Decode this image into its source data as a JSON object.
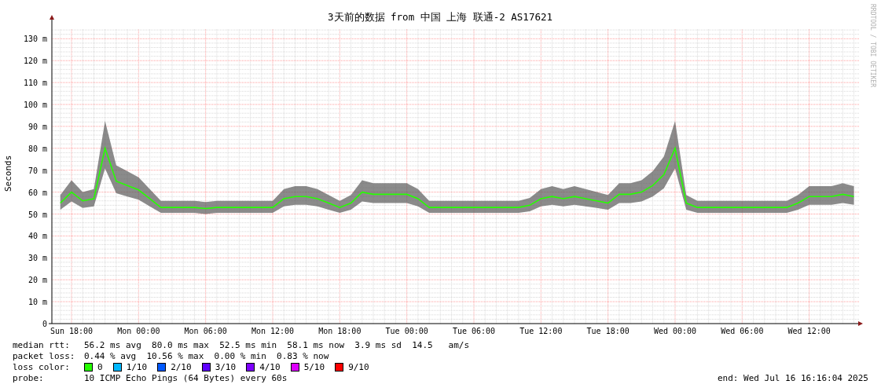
{
  "credit": "RRDTOOL / TOBI OETIKER",
  "chart_data": {
    "type": "line",
    "title": "3天前的数据 from 中国 上海 联通-2 AS17621",
    "ylabel": "Seconds",
    "categories": [
      null,
      "Sun 18:00",
      null,
      null,
      null,
      null,
      null,
      "Mon 00:00",
      null,
      null,
      null,
      null,
      null,
      "Mon 06:00",
      null,
      null,
      null,
      null,
      null,
      "Mon 12:00",
      null,
      null,
      null,
      null,
      null,
      "Mon 18:00",
      null,
      null,
      null,
      null,
      null,
      "Tue 00:00",
      null,
      null,
      null,
      null,
      null,
      "Tue 06:00",
      null,
      null,
      null,
      null,
      null,
      "Tue 12:00",
      null,
      null,
      null,
      null,
      null,
      "Tue 18:00",
      null,
      null,
      null,
      null,
      null,
      "Wed 00:00",
      null,
      null,
      null,
      null,
      null,
      "Wed 06:00",
      null,
      null,
      null,
      null,
      null,
      "Wed 12:00",
      null,
      null,
      null,
      null
    ],
    "series": [
      {
        "color": "#26ff00",
        "values": [
          55,
          60,
          56,
          57,
          80,
          65,
          63,
          61,
          57,
          53,
          53,
          53,
          53,
          52.5,
          53,
          53,
          53,
          53,
          53,
          53,
          57,
          58,
          58,
          57,
          55,
          53,
          55,
          60,
          59,
          59,
          59,
          59,
          57,
          53,
          53,
          53,
          53,
          53,
          53,
          53,
          53,
          53,
          54,
          57,
          58,
          57,
          58,
          57,
          56,
          55,
          59,
          59,
          60,
          63,
          68,
          80,
          55,
          53,
          53,
          53,
          53,
          53,
          53,
          53,
          53,
          53,
          55,
          58,
          58,
          58,
          59,
          58
        ]
      }
    ],
    "ylim": [
      0,
      130
    ],
    "grid": true,
    "yticks": [
      {
        "value": 0,
        "label": "0"
      },
      {
        "value": 10,
        "label": "10 m"
      },
      {
        "value": 20,
        "label": "20 m"
      },
      {
        "value": 30,
        "label": "30 m"
      },
      {
        "value": 40,
        "label": "40 m"
      },
      {
        "value": 50,
        "label": "50 m"
      },
      {
        "value": 60,
        "label": "60 m"
      },
      {
        "value": 70,
        "label": "70 m"
      },
      {
        "value": 80,
        "label": "80 m"
      },
      {
        "value": 90,
        "label": "90 m"
      },
      {
        "value": 100,
        "label": "100 m"
      },
      {
        "value": 110,
        "label": "110 m"
      },
      {
        "value": 120,
        "label": "120 m"
      },
      {
        "value": 130,
        "label": "130 m"
      }
    ]
  },
  "stats": [
    {
      "label": "median rtt:",
      "text": "56.2 ms avg  80.0 ms max  52.5 ms min  58.1 ms now  3.9 ms sd  14.5   am/s"
    },
    {
      "label": "packet loss:",
      "text": "0.44 % avg  10.56 % max  0.00 % min  0.83 % now"
    }
  ],
  "loss_color": {
    "label": "loss color:",
    "items": [
      {
        "label": "0",
        "color": "#26ff00"
      },
      {
        "label": "1/10",
        "color": "#00b8ff"
      },
      {
        "label": "2/10",
        "color": "#0059ff"
      },
      {
        "label": "3/10",
        "color": "#5e00ff"
      },
      {
        "label": "4/10",
        "color": "#7e00ff"
      },
      {
        "label": "5/10",
        "color": "#dd00ff"
      },
      {
        "label": "9/10",
        "color": "#ff0000"
      }
    ]
  },
  "probe": {
    "label": "probe:",
    "text": "10 ICMP Echo Pings (64 Bytes) every 60s"
  },
  "end": "end: Wed Jul 16 16:16:04 2025"
}
